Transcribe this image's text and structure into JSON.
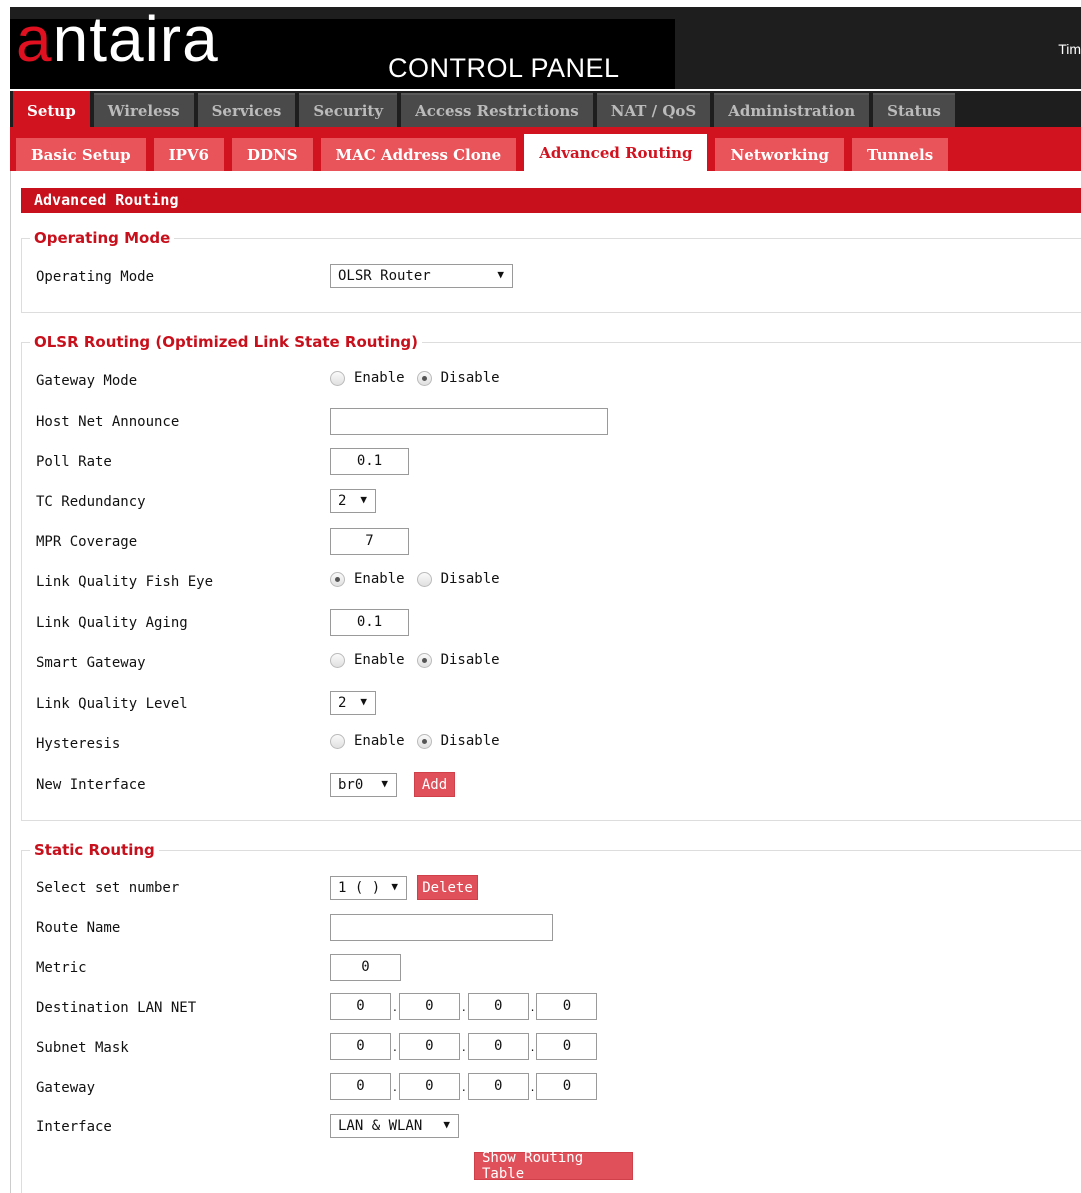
{
  "header": {
    "logo_first": "a",
    "logo_rest": "ntaira",
    "subtitle": "CONTROL PANEL",
    "time_label": "Tim"
  },
  "main_tabs": [
    {
      "label": "Setup",
      "active": true
    },
    {
      "label": "Wireless",
      "active": false
    },
    {
      "label": "Services",
      "active": false
    },
    {
      "label": "Security",
      "active": false
    },
    {
      "label": "Access Restrictions",
      "active": false
    },
    {
      "label": "NAT / QoS",
      "active": false
    },
    {
      "label": "Administration",
      "active": false
    },
    {
      "label": "Status",
      "active": false
    }
  ],
  "sub_tabs": [
    {
      "label": "Basic Setup",
      "active": false
    },
    {
      "label": "IPV6",
      "active": false
    },
    {
      "label": "DDNS",
      "active": false
    },
    {
      "label": "MAC Address Clone",
      "active": false
    },
    {
      "label": "Advanced Routing",
      "active": true
    },
    {
      "label": "Networking",
      "active": false
    },
    {
      "label": "Tunnels",
      "active": false
    }
  ],
  "page_title": "Advanced Routing",
  "operating_mode": {
    "legend": "Operating Mode",
    "label": "Operating Mode",
    "value": "OLSR Router"
  },
  "olsr": {
    "legend": "OLSR Routing (Optimized Link State Routing)",
    "enable_label": "Enable",
    "disable_label": "Disable",
    "gateway_mode": {
      "label": "Gateway Mode",
      "selected": "Disable"
    },
    "host_net_announce": {
      "label": "Host Net Announce",
      "value": ""
    },
    "poll_rate": {
      "label": "Poll Rate",
      "value": "0.1"
    },
    "tc_redundancy": {
      "label": "TC Redundancy",
      "value": "2"
    },
    "mpr_coverage": {
      "label": "MPR Coverage",
      "value": "7"
    },
    "lq_fish_eye": {
      "label": "Link Quality Fish Eye",
      "selected": "Enable"
    },
    "lq_aging": {
      "label": "Link Quality Aging",
      "value": "0.1"
    },
    "smart_gateway": {
      "label": "Smart Gateway",
      "selected": "Disable"
    },
    "lq_level": {
      "label": "Link Quality Level",
      "value": "2"
    },
    "hysteresis": {
      "label": "Hysteresis",
      "selected": "Disable"
    },
    "new_interface": {
      "label": "New Interface",
      "value": "br0",
      "add_label": "Add"
    }
  },
  "static_routing": {
    "legend": "Static Routing",
    "select_set": {
      "label": "Select set number",
      "value": "1 ( )",
      "delete_label": "Delete"
    },
    "route_name": {
      "label": "Route Name",
      "value": ""
    },
    "metric": {
      "label": "Metric",
      "value": "0"
    },
    "dest_lan_net": {
      "label": "Destination LAN NET",
      "octets": [
        "0",
        "0",
        "0",
        "0"
      ]
    },
    "subnet_mask": {
      "label": "Subnet Mask",
      "octets": [
        "0",
        "0",
        "0",
        "0"
      ]
    },
    "gateway": {
      "label": "Gateway",
      "octets": [
        "0",
        "0",
        "0",
        "0"
      ]
    },
    "interface": {
      "label": "Interface",
      "value": "LAN & WLAN"
    },
    "show_table_label": "Show Routing Table"
  },
  "colors": {
    "brand_red": "#d11320",
    "tab_inactive": "#4a4a4a",
    "subtab_inactive": "#e8545a",
    "button": "#e0505a"
  }
}
